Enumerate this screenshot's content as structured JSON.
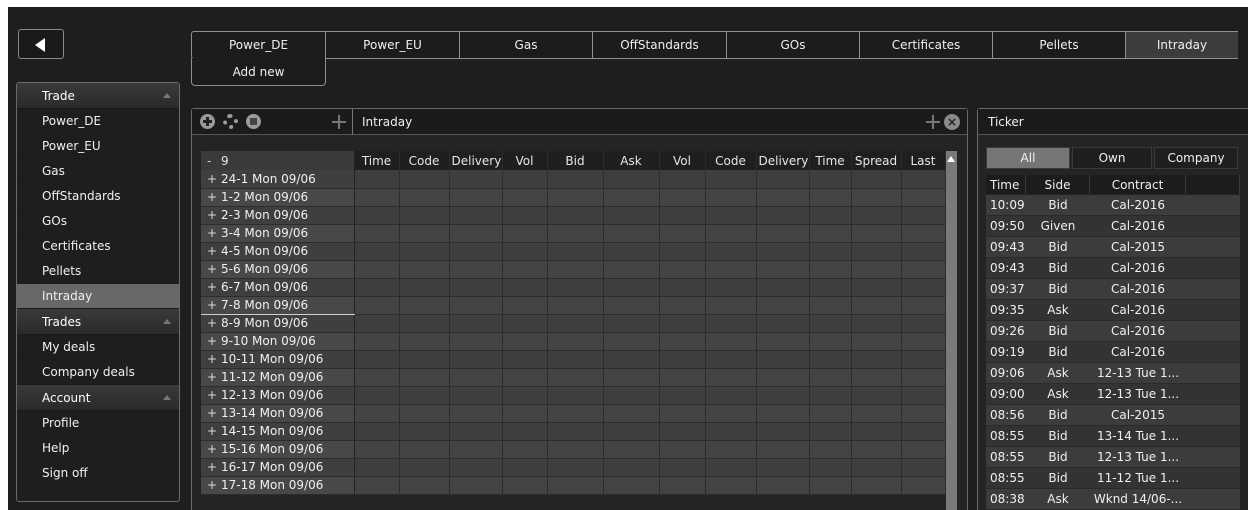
{
  "top_tabs": [
    "Power_DE",
    "Power_EU",
    "Gas",
    "OffStandards",
    "GOs",
    "Certificates",
    "Pellets",
    "Intraday"
  ],
  "active_top_tab": "Intraday",
  "add_new_label": "Add new",
  "sidebar": {
    "trade_header": "Trade",
    "trade_items": [
      "Power_DE",
      "Power_EU",
      "Gas",
      "OffStandards",
      "GOs",
      "Certificates",
      "Pellets",
      "Intraday"
    ],
    "active_item": "Intraday",
    "trades_header": "Trades",
    "trades_items": [
      "My deals",
      "Company deals"
    ],
    "account_header": "Account",
    "account_items": [
      "Profile",
      "Help",
      "Sign off"
    ]
  },
  "intraday_panel": {
    "title": "Intraday",
    "close_glyph": "×",
    "group_toggle": "-",
    "group_label": "9",
    "columns": [
      "Time",
      "Code",
      "Delivery",
      "Vol",
      "Bid",
      "Ask",
      "Vol",
      "Code",
      "Delivery",
      "Time",
      "Spread",
      "Last"
    ],
    "rows": [
      "24-1 Mon 09/06",
      "1-2 Mon 09/06",
      "2-3 Mon 09/06",
      "3-4 Mon 09/06",
      "4-5 Mon 09/06",
      "5-6 Mon 09/06",
      "6-7 Mon 09/06",
      "7-8 Mon 09/06",
      "8-9 Mon 09/06",
      "9-10 Mon 09/06",
      "10-11 Mon 09/06",
      "11-12 Mon 09/06",
      "12-13 Mon 09/06",
      "13-14 Mon 09/06",
      "14-15 Mon 09/06",
      "15-16 Mon 09/06",
      "16-17 Mon 09/06",
      "17-18 Mon 09/06"
    ],
    "expand_glyph": "+"
  },
  "ticker": {
    "title": "Ticker",
    "filters": [
      "All",
      "Own",
      "Company"
    ],
    "active_filter": "All",
    "headers": [
      "Time",
      "Side",
      "Contract"
    ],
    "rows": [
      {
        "time": "10:09",
        "side": "Bid",
        "contract": "Cal-2016"
      },
      {
        "time": "09:50",
        "side": "Given",
        "contract": "Cal-2016"
      },
      {
        "time": "09:43",
        "side": "Bid",
        "contract": "Cal-2015"
      },
      {
        "time": "09:43",
        "side": "Bid",
        "contract": "Cal-2016"
      },
      {
        "time": "09:37",
        "side": "Bid",
        "contract": "Cal-2016"
      },
      {
        "time": "09:35",
        "side": "Ask",
        "contract": "Cal-2016"
      },
      {
        "time": "09:26",
        "side": "Bid",
        "contract": "Cal-2016"
      },
      {
        "time": "09:19",
        "side": "Bid",
        "contract": "Cal-2016"
      },
      {
        "time": "09:06",
        "side": "Ask",
        "contract": "12-13 Tue 1..."
      },
      {
        "time": "09:00",
        "side": "Ask",
        "contract": "12-13 Tue 1..."
      },
      {
        "time": "08:56",
        "side": "Bid",
        "contract": "Cal-2015"
      },
      {
        "time": "08:55",
        "side": "Bid",
        "contract": "13-14 Tue 1..."
      },
      {
        "time": "08:55",
        "side": "Bid",
        "contract": "12-13 Tue 1..."
      },
      {
        "time": "08:55",
        "side": "Bid",
        "contract": "11-12 Tue 1..."
      },
      {
        "time": "08:38",
        "side": "Ask",
        "contract": "Wknd 14/06-..."
      }
    ]
  }
}
